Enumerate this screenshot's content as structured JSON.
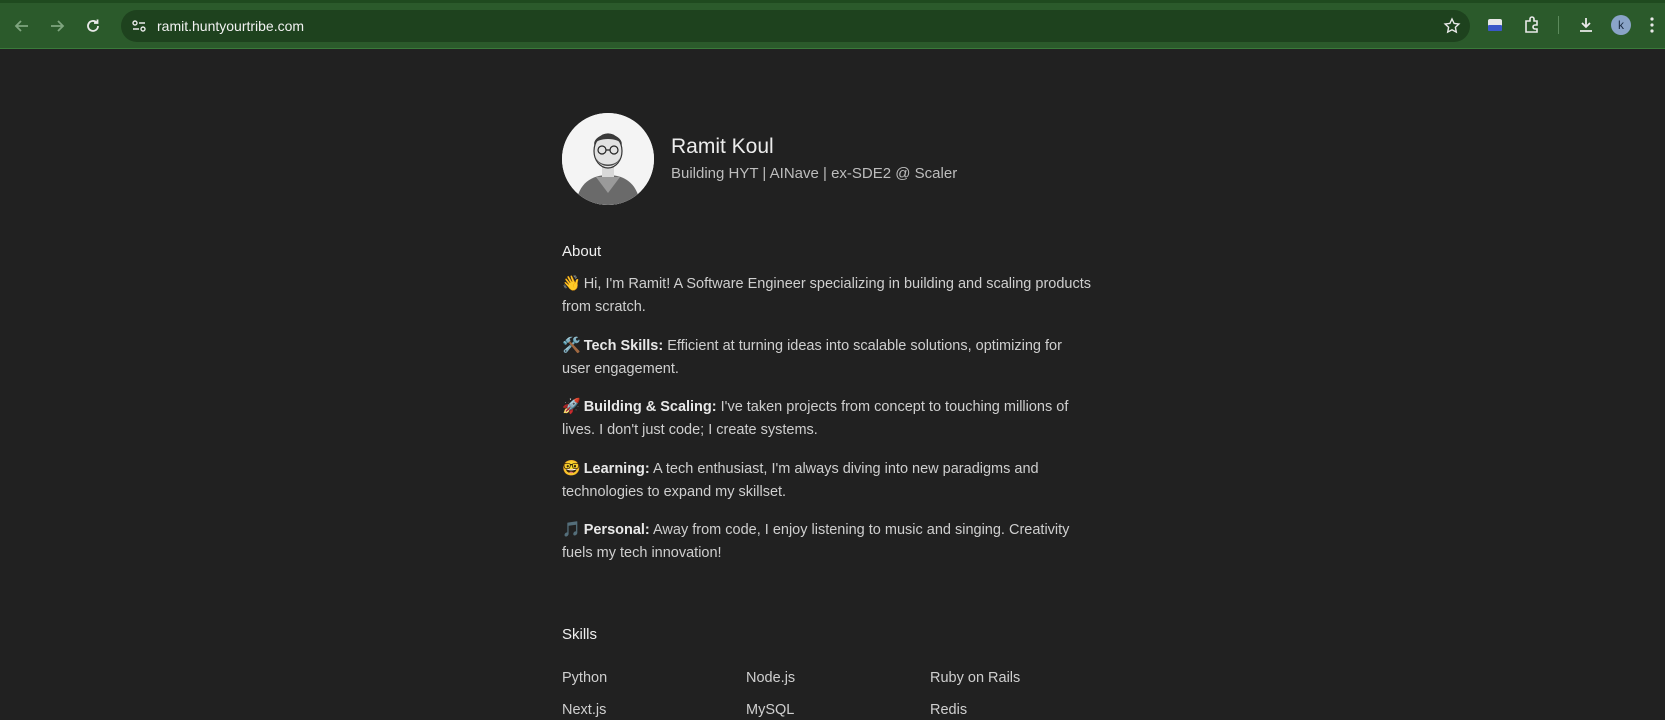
{
  "browser": {
    "url": "ramit.huntyourtribe.com",
    "profile_initial": "k",
    "icons": [
      "back-arrow-icon",
      "forward-arrow-icon",
      "reload-icon",
      "site-settings-icon",
      "bookmark-star-icon",
      "extension-puzzle-icon",
      "download-icon",
      "more-menu-icon"
    ]
  },
  "profile": {
    "name": "Ramit Koul",
    "tagline": "Building HYT | AINave | ex-SDE2 @ Scaler"
  },
  "about": {
    "title": "About",
    "paragraphs": [
      {
        "emoji": "👋",
        "bold": "",
        "text": "Hi, I'm Ramit! A Software Engineer specializing in building and scaling products from scratch."
      },
      {
        "emoji": "🛠️",
        "bold": "Tech Skills:",
        "text": "Efficient at turning ideas into scalable solutions, optimizing for user engagement."
      },
      {
        "emoji": "🚀",
        "bold": "Building & Scaling:",
        "text": "I've taken projects from concept to touching millions of lives. I don't just code; I create systems."
      },
      {
        "emoji": "🤓",
        "bold": "Learning:",
        "text": "A tech enthusiast, I'm always diving into new paradigms and technologies to expand my skillset."
      },
      {
        "emoji": "🎵",
        "bold": "Personal:",
        "text": "Away from code, I enjoy listening to music and singing. Creativity fuels my tech innovation!"
      }
    ]
  },
  "skills": {
    "title": "Skills",
    "items": [
      "Python",
      "Node.js",
      "Ruby on Rails",
      "Next.js",
      "MySQL",
      "Redis"
    ]
  },
  "colors": {
    "page_bg": "#212121",
    "toolbar_bg": "#2b5a2b"
  }
}
